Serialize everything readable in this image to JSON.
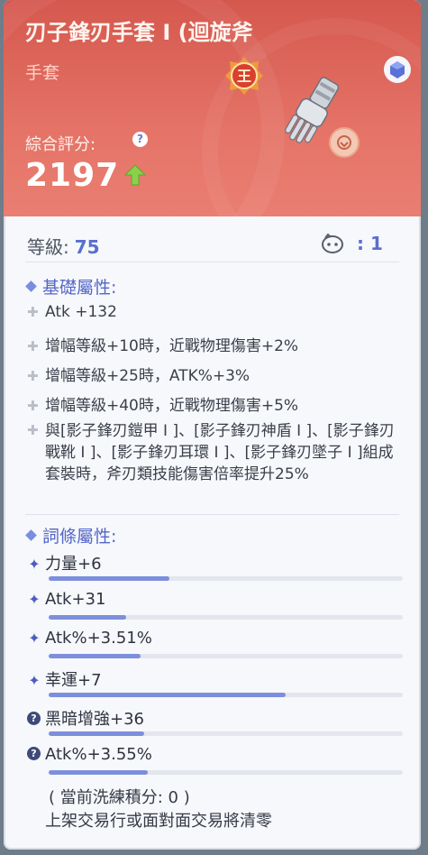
{
  "header": {
    "title": "刃子鋒刃手套 I (迴旋斧",
    "subtitle": "手套",
    "score_label": "綜合評分:",
    "score": "2197",
    "king_badge": "王"
  },
  "info": {
    "level_label": "等級:",
    "level": "75",
    "pet_count": ": 1"
  },
  "base": {
    "title": "基礎屬性:",
    "rows": [
      "Atk +132",
      "增幅等級+10時，近戰物理傷害+2%",
      "增幅等級+25時，ATK%+3%",
      "增幅等級+40時，近戰物理傷害+5%"
    ],
    "set_text": "與[影子鋒刃鎧甲 I ]、[影子鋒刃神盾 I ]、[影子鋒刃戰靴 I ]、[影子鋒刃耳環 I ]、[影子鋒刃墜子 I ]組成套裝時，斧刃類技能傷害倍率提升25%"
  },
  "affix": {
    "title": "詞條屬性:",
    "items": [
      {
        "label": "力量+6",
        "icon": "sparkle-icon",
        "fill": 0.34
      },
      {
        "label": "Atk+31",
        "icon": "sparkle-icon",
        "fill": 0.22
      },
      {
        "label": "Atk%+3.51%",
        "icon": "sparkle-icon",
        "fill": 0.26
      },
      {
        "label": "幸運+7",
        "icon": "sparkle-icon",
        "fill": 0.67
      },
      {
        "label": "黑暗增強+36",
        "icon": "question-icon",
        "fill": 0.27
      },
      {
        "label": "Atk%+3.55%",
        "icon": "question-icon",
        "fill": 0.28
      }
    ]
  },
  "footer": {
    "line1": "( 當前洗練積分: 0 )",
    "line2": "上架交易行或面對面交易將清零"
  },
  "colors": {
    "header_top": "#d5584e",
    "accent_blue": "#5566c8",
    "bar_fill": "#7d8fdc",
    "up_arrow": "#8bd04a"
  }
}
